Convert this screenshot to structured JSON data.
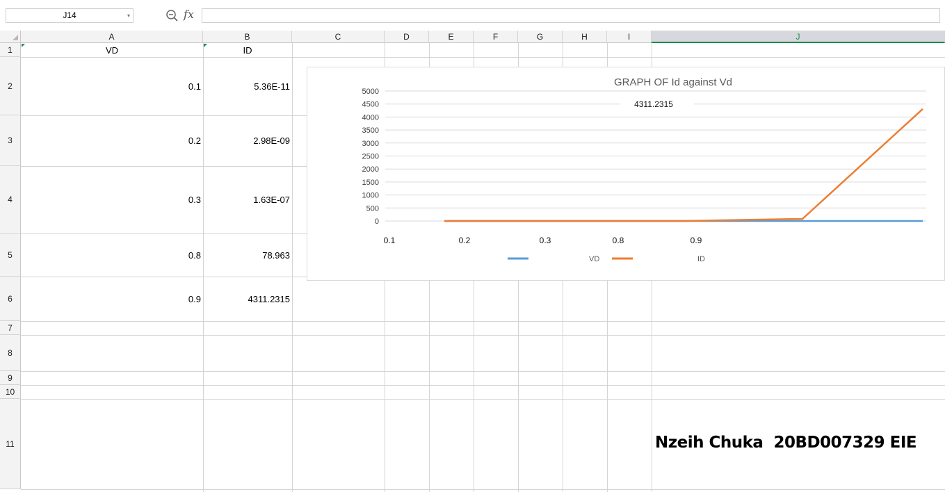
{
  "formula_bar": {
    "name_box": "J14",
    "zoom_icon": "zoom-icon",
    "fx_label": "fx",
    "formula": ""
  },
  "columns": [
    "A",
    "B",
    "C",
    "D",
    "E",
    "F",
    "G",
    "H",
    "I",
    "J"
  ],
  "selected_column": "J",
  "rows": [
    "1",
    "2",
    "3",
    "4",
    "5",
    "6",
    "7",
    "8",
    "9",
    "10",
    "11"
  ],
  "headers": {
    "A": "VD",
    "B": "ID"
  },
  "data_rows": [
    {
      "vd": "0.1",
      "id": "5.36E-11"
    },
    {
      "vd": "0.2",
      "id": "2.98E-09"
    },
    {
      "vd": "0.3",
      "id": "1.63E-07"
    },
    {
      "vd": "0.8",
      "id": "78.963"
    },
    {
      "vd": "0.9",
      "id": "4311.2315"
    }
  ],
  "signature": "Nzeih Chuka  20BD007329 EIE",
  "colors": {
    "vd": "#5b9bd5",
    "id": "#ed7d31",
    "selected": "#1f8a4c"
  },
  "chart_data": {
    "type": "line",
    "title": "GRAPH OF Id against Vd",
    "categories": [
      "0.1",
      "0.2",
      "0.3",
      "0.8",
      "0.9"
    ],
    "series": [
      {
        "name": "VD",
        "values": [
          0.1,
          0.2,
          0.3,
          0.8,
          0.9
        ]
      },
      {
        "name": "ID",
        "values": [
          5.36e-11,
          2.98e-09,
          1.63e-07,
          78.963,
          4311.2315
        ]
      }
    ],
    "ylim": [
      0,
      5000
    ],
    "yticks": [
      "0",
      "500",
      "1000",
      "1500",
      "2000",
      "2500",
      "3000",
      "3500",
      "4000",
      "4500",
      "5000"
    ],
    "data_label": "4311.2315",
    "grid": true,
    "legend": "bottom"
  }
}
